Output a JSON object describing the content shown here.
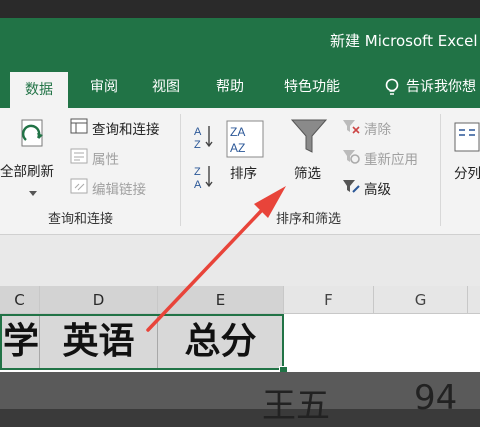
{
  "window": {
    "title": "新建 Microsoft Excel"
  },
  "tabs": [
    {
      "label": "数据",
      "active": true
    },
    {
      "label": "审阅"
    },
    {
      "label": "视图"
    },
    {
      "label": "帮助"
    },
    {
      "label": "特色功能"
    }
  ],
  "tell_me": {
    "label": "告诉我你想"
  },
  "ribbon": {
    "refresh_all": "全部刷新",
    "queries_connections": "查询和连接",
    "properties": "属性",
    "edit_links": "编辑链接",
    "group_queries": "查询和连接",
    "sort": "排序",
    "filter": "筛选",
    "clear": "清除",
    "reapply": "重新应用",
    "advanced": "高级",
    "group_sort_filter": "排序和筛选",
    "split": "分列",
    "sort_az_icon_text": "AZ",
    "sort_za_icon_text": "ZA"
  },
  "grid": {
    "columns": [
      "C",
      "D",
      "E",
      "F",
      "G"
    ],
    "cells": [
      "学",
      "英语",
      "总分"
    ],
    "below_text": [
      "王五",
      "94"
    ]
  },
  "colors": {
    "accent": "#217346",
    "arrow": "#e8443a"
  }
}
